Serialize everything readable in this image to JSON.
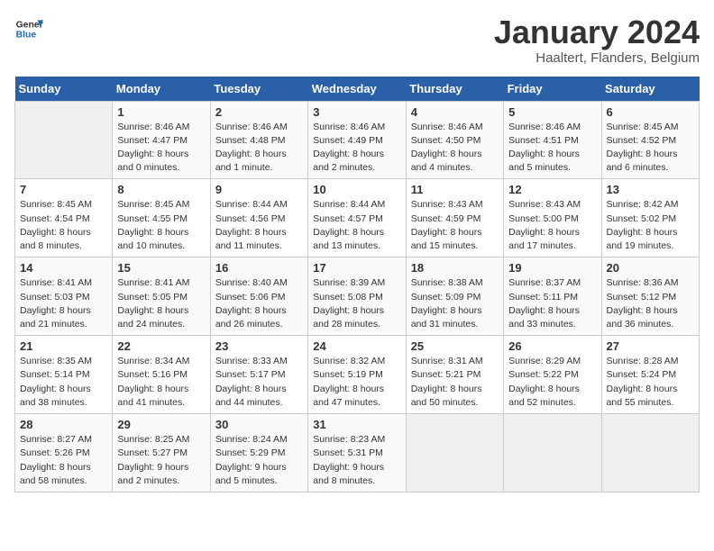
{
  "header": {
    "logo_line1": "General",
    "logo_line2": "Blue",
    "month": "January 2024",
    "location": "Haaltert, Flanders, Belgium"
  },
  "weekdays": [
    "Sunday",
    "Monday",
    "Tuesday",
    "Wednesday",
    "Thursday",
    "Friday",
    "Saturday"
  ],
  "weeks": [
    [
      {
        "day": "",
        "sunrise": "",
        "sunset": "",
        "daylight": ""
      },
      {
        "day": "1",
        "sunrise": "Sunrise: 8:46 AM",
        "sunset": "Sunset: 4:47 PM",
        "daylight": "Daylight: 8 hours and 0 minutes."
      },
      {
        "day": "2",
        "sunrise": "Sunrise: 8:46 AM",
        "sunset": "Sunset: 4:48 PM",
        "daylight": "Daylight: 8 hours and 1 minute."
      },
      {
        "day": "3",
        "sunrise": "Sunrise: 8:46 AM",
        "sunset": "Sunset: 4:49 PM",
        "daylight": "Daylight: 8 hours and 2 minutes."
      },
      {
        "day": "4",
        "sunrise": "Sunrise: 8:46 AM",
        "sunset": "Sunset: 4:50 PM",
        "daylight": "Daylight: 8 hours and 4 minutes."
      },
      {
        "day": "5",
        "sunrise": "Sunrise: 8:46 AM",
        "sunset": "Sunset: 4:51 PM",
        "daylight": "Daylight: 8 hours and 5 minutes."
      },
      {
        "day": "6",
        "sunrise": "Sunrise: 8:45 AM",
        "sunset": "Sunset: 4:52 PM",
        "daylight": "Daylight: 8 hours and 6 minutes."
      }
    ],
    [
      {
        "day": "7",
        "sunrise": "Sunrise: 8:45 AM",
        "sunset": "Sunset: 4:54 PM",
        "daylight": "Daylight: 8 hours and 8 minutes."
      },
      {
        "day": "8",
        "sunrise": "Sunrise: 8:45 AM",
        "sunset": "Sunset: 4:55 PM",
        "daylight": "Daylight: 8 hours and 10 minutes."
      },
      {
        "day": "9",
        "sunrise": "Sunrise: 8:44 AM",
        "sunset": "Sunset: 4:56 PM",
        "daylight": "Daylight: 8 hours and 11 minutes."
      },
      {
        "day": "10",
        "sunrise": "Sunrise: 8:44 AM",
        "sunset": "Sunset: 4:57 PM",
        "daylight": "Daylight: 8 hours and 13 minutes."
      },
      {
        "day": "11",
        "sunrise": "Sunrise: 8:43 AM",
        "sunset": "Sunset: 4:59 PM",
        "daylight": "Daylight: 8 hours and 15 minutes."
      },
      {
        "day": "12",
        "sunrise": "Sunrise: 8:43 AM",
        "sunset": "Sunset: 5:00 PM",
        "daylight": "Daylight: 8 hours and 17 minutes."
      },
      {
        "day": "13",
        "sunrise": "Sunrise: 8:42 AM",
        "sunset": "Sunset: 5:02 PM",
        "daylight": "Daylight: 8 hours and 19 minutes."
      }
    ],
    [
      {
        "day": "14",
        "sunrise": "Sunrise: 8:41 AM",
        "sunset": "Sunset: 5:03 PM",
        "daylight": "Daylight: 8 hours and 21 minutes."
      },
      {
        "day": "15",
        "sunrise": "Sunrise: 8:41 AM",
        "sunset": "Sunset: 5:05 PM",
        "daylight": "Daylight: 8 hours and 24 minutes."
      },
      {
        "day": "16",
        "sunrise": "Sunrise: 8:40 AM",
        "sunset": "Sunset: 5:06 PM",
        "daylight": "Daylight: 8 hours and 26 minutes."
      },
      {
        "day": "17",
        "sunrise": "Sunrise: 8:39 AM",
        "sunset": "Sunset: 5:08 PM",
        "daylight": "Daylight: 8 hours and 28 minutes."
      },
      {
        "day": "18",
        "sunrise": "Sunrise: 8:38 AM",
        "sunset": "Sunset: 5:09 PM",
        "daylight": "Daylight: 8 hours and 31 minutes."
      },
      {
        "day": "19",
        "sunrise": "Sunrise: 8:37 AM",
        "sunset": "Sunset: 5:11 PM",
        "daylight": "Daylight: 8 hours and 33 minutes."
      },
      {
        "day": "20",
        "sunrise": "Sunrise: 8:36 AM",
        "sunset": "Sunset: 5:12 PM",
        "daylight": "Daylight: 8 hours and 36 minutes."
      }
    ],
    [
      {
        "day": "21",
        "sunrise": "Sunrise: 8:35 AM",
        "sunset": "Sunset: 5:14 PM",
        "daylight": "Daylight: 8 hours and 38 minutes."
      },
      {
        "day": "22",
        "sunrise": "Sunrise: 8:34 AM",
        "sunset": "Sunset: 5:16 PM",
        "daylight": "Daylight: 8 hours and 41 minutes."
      },
      {
        "day": "23",
        "sunrise": "Sunrise: 8:33 AM",
        "sunset": "Sunset: 5:17 PM",
        "daylight": "Daylight: 8 hours and 44 minutes."
      },
      {
        "day": "24",
        "sunrise": "Sunrise: 8:32 AM",
        "sunset": "Sunset: 5:19 PM",
        "daylight": "Daylight: 8 hours and 47 minutes."
      },
      {
        "day": "25",
        "sunrise": "Sunrise: 8:31 AM",
        "sunset": "Sunset: 5:21 PM",
        "daylight": "Daylight: 8 hours and 50 minutes."
      },
      {
        "day": "26",
        "sunrise": "Sunrise: 8:29 AM",
        "sunset": "Sunset: 5:22 PM",
        "daylight": "Daylight: 8 hours and 52 minutes."
      },
      {
        "day": "27",
        "sunrise": "Sunrise: 8:28 AM",
        "sunset": "Sunset: 5:24 PM",
        "daylight": "Daylight: 8 hours and 55 minutes."
      }
    ],
    [
      {
        "day": "28",
        "sunrise": "Sunrise: 8:27 AM",
        "sunset": "Sunset: 5:26 PM",
        "daylight": "Daylight: 8 hours and 58 minutes."
      },
      {
        "day": "29",
        "sunrise": "Sunrise: 8:25 AM",
        "sunset": "Sunset: 5:27 PM",
        "daylight": "Daylight: 9 hours and 2 minutes."
      },
      {
        "day": "30",
        "sunrise": "Sunrise: 8:24 AM",
        "sunset": "Sunset: 5:29 PM",
        "daylight": "Daylight: 9 hours and 5 minutes."
      },
      {
        "day": "31",
        "sunrise": "Sunrise: 8:23 AM",
        "sunset": "Sunset: 5:31 PM",
        "daylight": "Daylight: 9 hours and 8 minutes."
      },
      {
        "day": "",
        "sunrise": "",
        "sunset": "",
        "daylight": ""
      },
      {
        "day": "",
        "sunrise": "",
        "sunset": "",
        "daylight": ""
      },
      {
        "day": "",
        "sunrise": "",
        "sunset": "",
        "daylight": ""
      }
    ]
  ]
}
